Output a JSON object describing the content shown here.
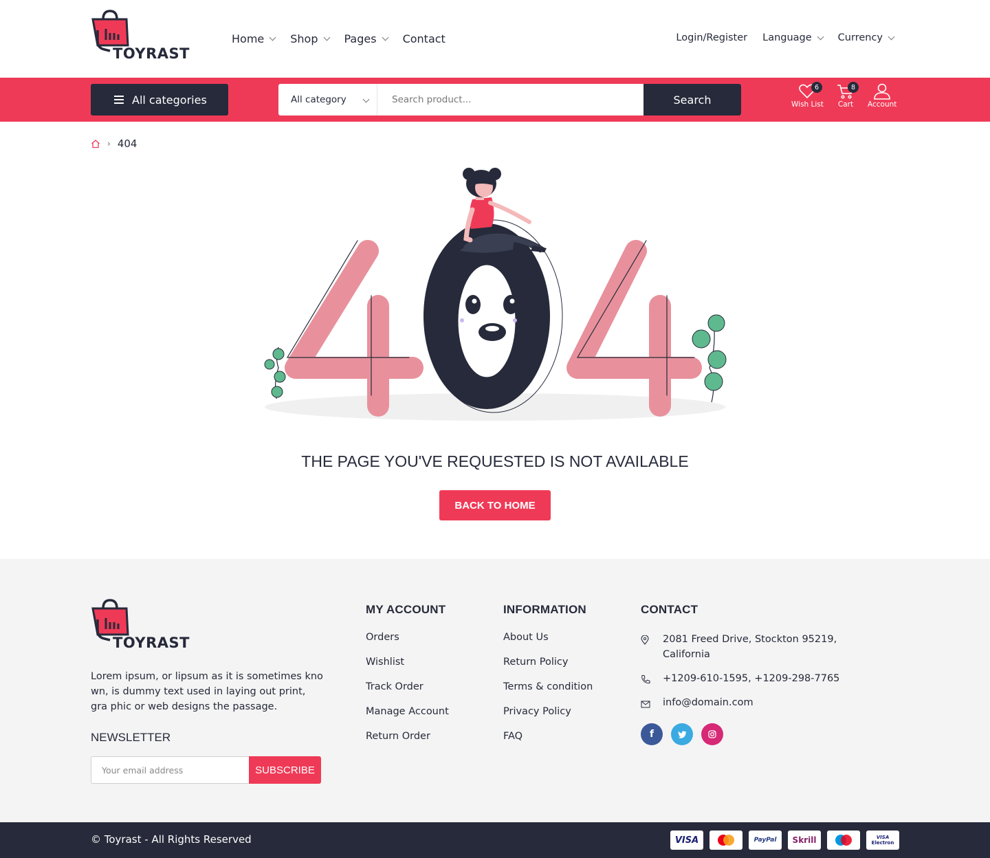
{
  "brand": {
    "name": "TOYRAST"
  },
  "nav": {
    "items": [
      {
        "label": "Home",
        "has_dropdown": true
      },
      {
        "label": "Shop",
        "has_dropdown": true
      },
      {
        "label": "Pages",
        "has_dropdown": true
      },
      {
        "label": "Contact",
        "has_dropdown": false
      }
    ],
    "login": "Login/Register",
    "language": "Language",
    "currency": "Currency"
  },
  "searchbar": {
    "all_categories": "All categories",
    "category_select": "All category",
    "placeholder": "Search product...",
    "search_button": "Search"
  },
  "header_icons": {
    "wishlist": {
      "label": "Wish List",
      "count": "6"
    },
    "cart": {
      "label": "Cart",
      "count": "8"
    },
    "account": {
      "label": "Account"
    }
  },
  "breadcrumb": {
    "current": "404"
  },
  "error": {
    "code": "404",
    "title": "THE PAGE YOU'VE REQUESTED IS NOT AVAILABLE",
    "button": "BACK TO HOME"
  },
  "footer": {
    "about": "Lorem ipsum, or lipsum as it is sometimes kno wn, is dummy text used in laying out print, gra phic or web designs the passage.",
    "newsletter": {
      "title": "NEWSLETTER",
      "placeholder": "Your email address",
      "button": "SUBSCRIBE"
    },
    "my_account": {
      "title": "MY ACCOUNT",
      "links": [
        "Orders",
        "Wishlist",
        "Track Order",
        "Manage Account",
        "Return Order"
      ]
    },
    "information": {
      "title": "INFORMATION",
      "links": [
        "About Us",
        "Return Policy",
        "Terms & condition",
        "Privacy Policy",
        "FAQ"
      ]
    },
    "contact": {
      "title": "CONTACT",
      "address_line1": "2081 Freed Drive, Stockton 95219,",
      "address_line2": "California",
      "phone": "+1209-610-1595, +1209-298-7765",
      "email": "info@domain.com"
    },
    "socials": [
      "facebook-icon",
      "twitter-icon",
      "instagram-icon"
    ],
    "copyright": "© Toyrast - All Rights Reserved",
    "payments": [
      "VISA",
      "MasterCard",
      "PayPal",
      "Skrill",
      "Maestro",
      "VISA Electron"
    ]
  },
  "colors": {
    "accent": "#ef3a57",
    "dark": "#262a3a",
    "footer_bg": "#f4f4f4"
  }
}
